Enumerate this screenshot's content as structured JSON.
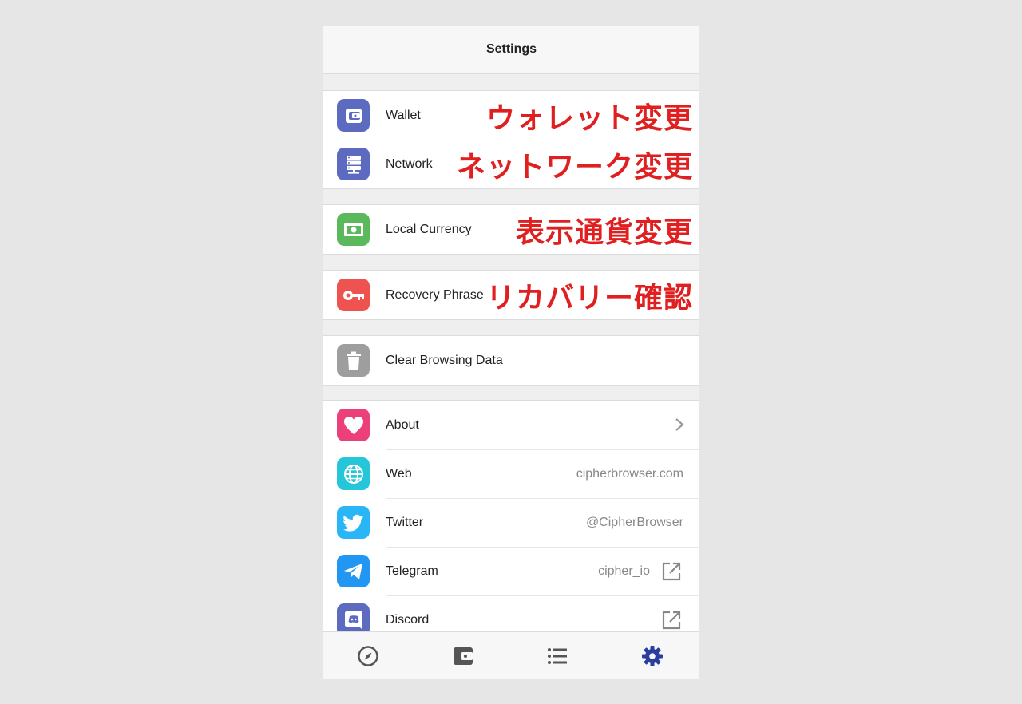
{
  "header": {
    "title": "Settings"
  },
  "groups": {
    "wallet": {
      "label": "Wallet",
      "annotation": "ウォレット変更",
      "icon": "wallet-icon",
      "color": "#5c6bc0"
    },
    "network": {
      "label": "Network",
      "annotation": "ネットワーク変更",
      "icon": "server-icon",
      "color": "#5c6bc0"
    },
    "currency": {
      "label": "Local Currency",
      "annotation": "表示通貨変更",
      "icon": "money-icon",
      "color": "#5cb85c"
    },
    "recovery": {
      "label": "Recovery Phrase",
      "annotation": "リカバリー確認",
      "icon": "key-icon",
      "color": "#ef5350"
    },
    "clear": {
      "label": "Clear Browsing Data",
      "icon": "trash-icon",
      "color": "#9e9e9e"
    }
  },
  "info": {
    "about": {
      "label": "About",
      "icon": "heart-icon",
      "color": "#ec407a"
    },
    "web": {
      "label": "Web",
      "value": "cipherbrowser.com",
      "icon": "globe-icon",
      "color": "#26c6da"
    },
    "twitter": {
      "label": "Twitter",
      "value": "@CipherBrowser",
      "icon": "twitter-icon",
      "color": "#29b6f6"
    },
    "telegram": {
      "label": "Telegram",
      "value": "cipher_io",
      "icon": "telegram-icon",
      "color": "#2196f3"
    },
    "discord": {
      "label": "Discord",
      "icon": "discord-icon",
      "color": "#5c6bc0"
    }
  },
  "tabbar": {
    "tabs": [
      "compass-icon",
      "wallet-icon",
      "list-icon",
      "gear-icon"
    ],
    "active_color": "#2a3f9d"
  }
}
